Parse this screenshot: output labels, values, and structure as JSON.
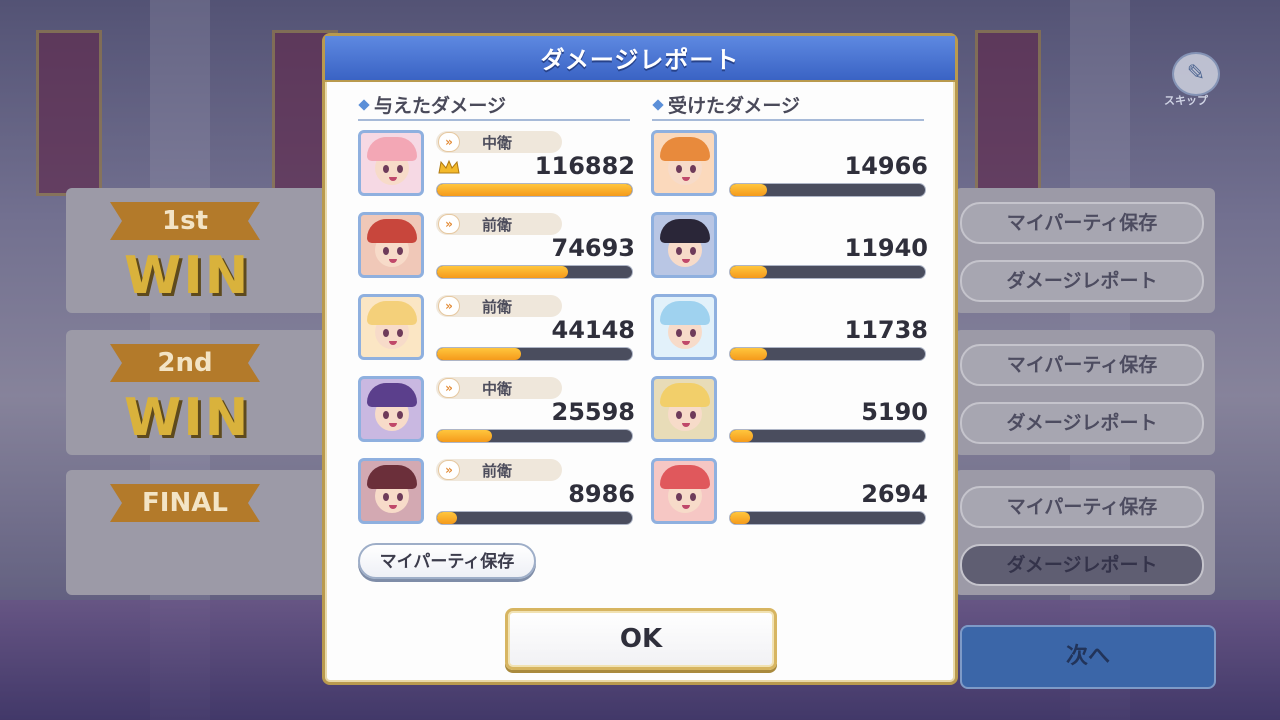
{
  "dialog": {
    "title": "ダメージレポート",
    "dealt_header": "与えたダメージ",
    "taken_header": "受けたダメージ",
    "save_button": "マイパーティ保存",
    "ok_button": "OK"
  },
  "dealt": [
    {
      "role": "中衛",
      "value": "116882",
      "fill": 1.0,
      "crown": true,
      "hair": "#f3a7b5",
      "bg": "#f6d9e4"
    },
    {
      "role": "前衛",
      "value": "74693",
      "fill": 0.67,
      "crown": false,
      "hair": "#c8463c",
      "bg": "#f0c8b8"
    },
    {
      "role": "前衛",
      "value": "44148",
      "fill": 0.43,
      "crown": false,
      "hair": "#f4d07a",
      "bg": "#fbe6c4"
    },
    {
      "role": "中衛",
      "value": "25598",
      "fill": 0.28,
      "crown": false,
      "hair": "#5b3f8c",
      "bg": "#c9b8e1"
    },
    {
      "role": "前衛",
      "value": "8986",
      "fill": 0.1,
      "crown": false,
      "hair": "#6b2f3a",
      "bg": "#d3a9b2"
    }
  ],
  "taken": [
    {
      "value": "14966",
      "fill": 0.19,
      "hair": "#e88a3c",
      "bg": "#fbd9bc"
    },
    {
      "value": "11940",
      "fill": 0.19,
      "hair": "#2a2638",
      "bg": "#b9c6e4"
    },
    {
      "value": "11738",
      "fill": 0.19,
      "hair": "#9fd2ef",
      "bg": "#e2f1fa"
    },
    {
      "value": "5190",
      "fill": 0.12,
      "hair": "#f2cf6a",
      "bg": "#e8dcb8"
    },
    {
      "value": "2694",
      "fill": 0.1,
      "hair": "#e0585c",
      "bg": "#f6c7c4"
    }
  ],
  "background": {
    "round_1": "1st",
    "round_2": "2nd",
    "round_final": "FINAL",
    "win": "WIN",
    "save_party": "マイパーティ保存",
    "damage_report": "ダメージレポート",
    "next": "次へ",
    "skip_label": "スキップ"
  },
  "colors": {
    "header_blue": "#3a63c4",
    "bar_fill": "#f59a1b",
    "gold_border": "#b99a4e"
  }
}
